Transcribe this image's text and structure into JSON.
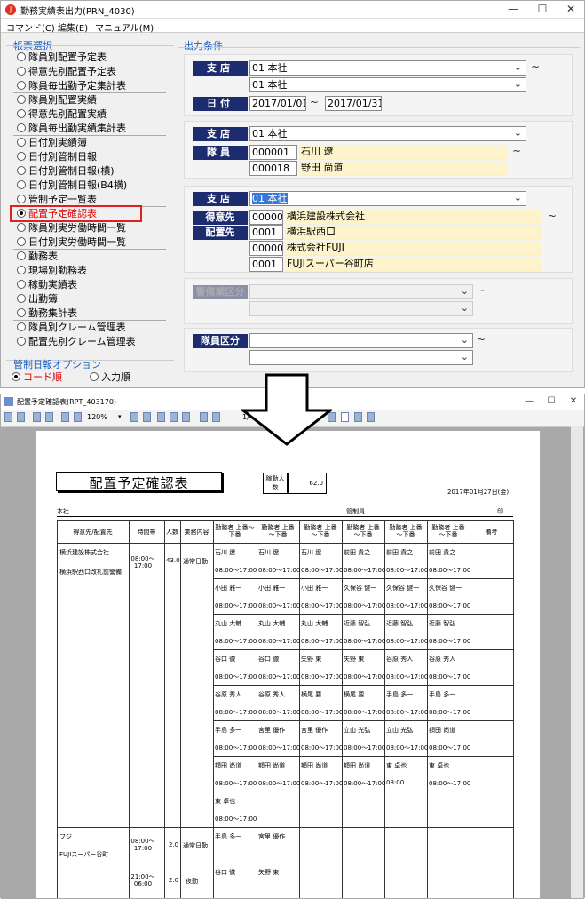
{
  "window1": {
    "title": "勤務実績表出力(PRN_4030)",
    "menu": [
      "コマンド(C)",
      "編集(E)",
      "マニュアル(M)"
    ],
    "report_group_label": "帳票選択",
    "report_items": [
      "隊員別配置予定表",
      "得意先別配置予定表",
      "隊員毎出勤予定集計表",
      "隊員別配置実績",
      "得意先別配置実績",
      "隊員毎出勤実績集計表",
      "日付別実績簿",
      "日付別管制日報",
      "日付別管制日報(横)",
      "日付別管制日報(B4横)",
      "管制予定一覧表",
      "配置予定確認表",
      "隊員別実労働時間一覧",
      "日付別実労働時間一覧",
      "勤務表",
      "現場別勤務表",
      "稼動実績表",
      "出勤簿",
      "勤務集計表",
      "隊員別クレーム管理表",
      "配置先別クレーム管理表"
    ],
    "selected_report": "配置予定確認表",
    "option_group_label": "管制日報オプション",
    "option_items": [
      "コード順",
      "入力順"
    ],
    "output_label": "出力条件",
    "branch": {
      "label": "支店",
      "value1": "01 本社",
      "value2": "01 本社"
    },
    "date": {
      "label": "日付",
      "from": "2017/01/01",
      "to": "2017/01/31"
    },
    "staff_branch": {
      "label": "支店",
      "value": "01 本社"
    },
    "staff": {
      "label": "隊員",
      "code1": "000001",
      "name1": "石川 遼",
      "code2": "000018",
      "name2": "野田 尚道"
    },
    "client_branch": {
      "label": "支店",
      "value": "01 本社"
    },
    "client": {
      "label": "得意先",
      "code": "000001",
      "name": "横浜建設株式会社"
    },
    "place": {
      "label": "配置先",
      "code1": "0001",
      "name1": "横浜駅西口",
      "code2": "000002",
      "name2": "株式会社FUJI",
      "code3": "0001",
      "name3": "FUJIスーパー谷町店"
    },
    "division_label": "警備業区分",
    "staff_type_label": "隊員区分",
    "tilde": "~"
  },
  "window2": {
    "title": "配置予定確認表(RPT_403170)",
    "zoom": "120%",
    "page_indicator": "1/"
  },
  "report": {
    "title": "配置予定確認表",
    "count_label": "稼動人数",
    "count_value": "62.0",
    "date": "2017年01月27日(金)",
    "branch": "本社",
    "manager_label": "管制員",
    "seal_label": "印",
    "headers": [
      "得意先/配置先",
      "時間帯",
      "人数",
      "業務内容",
      "勤務者 上番～下番",
      "勤務者 上番～下番",
      "勤務者 上番～下番",
      "勤務者 上番～下番",
      "勤務者 上番～下番",
      "勤務者 上番～下番",
      "備考"
    ],
    "row1_client": "横浜建設株式会社",
    "row1_place": "横浜駅西口改札前警備",
    "row1_time": "08:00～17:00",
    "row1_count": "43.0",
    "row1_task": "通常日勤",
    "row1_grid": [
      [
        "石川 遼",
        "石川 遼",
        "石川 遼",
        "前田 貴之",
        "前田 貴之",
        "前田 貴之"
      ],
      [
        "小田 雅一",
        "小田 雅一",
        "小田 雅一",
        "久保谷 健一",
        "久保谷 健一",
        "久保谷 健一"
      ],
      [
        "丸山 大輔",
        "丸山 大輔",
        "丸山 大輔",
        "近藤 智弘",
        "近藤 智弘",
        "近藤 智弘"
      ],
      [
        "谷口 徹",
        "谷口 徹",
        "矢野 東",
        "矢野 東",
        "谷原 秀人",
        "谷原 秀人"
      ],
      [
        "谷原 秀人",
        "谷原 秀人",
        "横尾 要",
        "横尾 要",
        "手島 多一",
        "手島 多一"
      ],
      [
        "手島 多一",
        "宮里 優作",
        "宮里 優作",
        "立山 光弘",
        "立山 光弘",
        "額田 尚道"
      ],
      [
        "額田 尚道",
        "額田 尚道",
        "額田 尚道",
        "額田 尚道",
        "東 卓也",
        "東 卓也"
      ],
      [
        "東 卓也",
        "",
        "",
        "",
        "",
        ""
      ]
    ],
    "shift_time": "08:00～17:00",
    "row2_client": "フジ",
    "row2_place": "FUJIスーパー谷町",
    "row2_time1": "08:00～17:00",
    "row2_count1": "2.0",
    "row2_task1": "通常日勤",
    "row2_staff1": [
      "手島 多一",
      "宮里 優作"
    ],
    "row2_time2": "21:00～06:00",
    "row2_count2": "2.0",
    "row2_task2": "夜勤",
    "row2_staff2": [
      "谷口 徹",
      "矢野 東"
    ],
    "alt_time": "08:00"
  }
}
